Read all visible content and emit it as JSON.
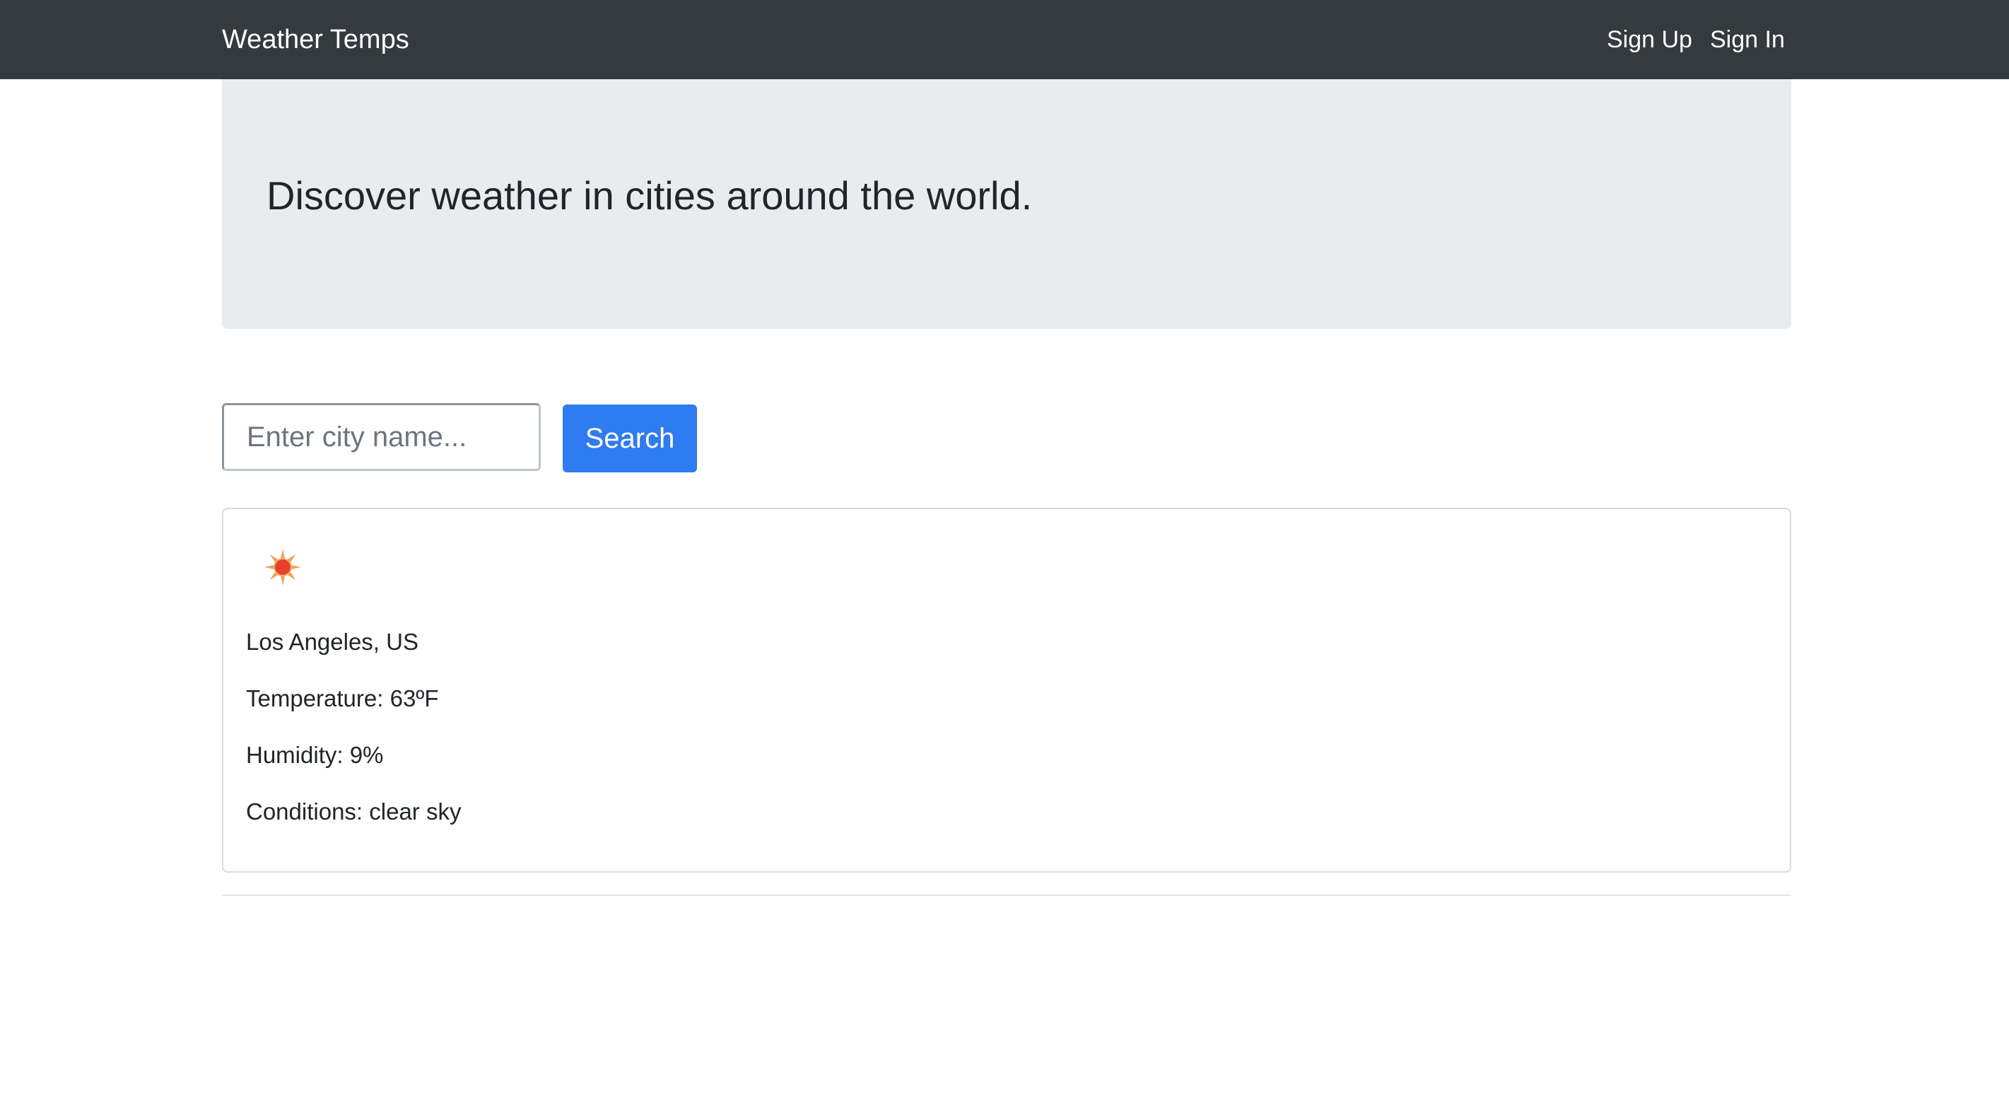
{
  "navbar": {
    "brand": "Weather Temps",
    "links": [
      {
        "label": "Sign Up"
      },
      {
        "label": "Sign In"
      }
    ],
    "background": "#343a40"
  },
  "jumbotron": {
    "title": "Discover weather in cities around the world."
  },
  "search": {
    "placeholder": "Enter city name...",
    "value": "",
    "button_label": "Search",
    "button_color": "#2f7bf0"
  },
  "result": {
    "icon": "sun-icon",
    "city": "Los Angeles, US",
    "temperature": "Temperature: 63ºF",
    "humidity": "Humidity: 9%",
    "conditions": "Conditions: clear sky"
  }
}
